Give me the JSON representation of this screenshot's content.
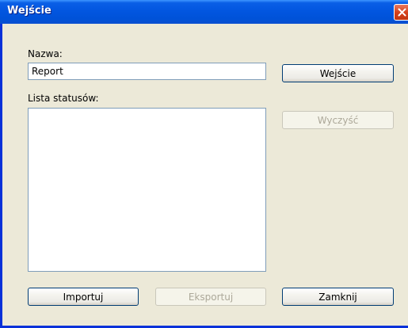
{
  "window": {
    "title": "Wejście"
  },
  "form": {
    "name_label": "Nazwa:",
    "name_value": "Report",
    "status_list_label": "Lista statusów:",
    "status_items": []
  },
  "buttons": {
    "enter": "Wejście",
    "clear": "Wyczyść",
    "import": "Importuj",
    "export": "Eksportuj",
    "close": "Zamknij"
  },
  "icons": {
    "close": "close-icon"
  },
  "colors": {
    "titlebar": "#0052d8",
    "window_bg": "#ece9d8",
    "close_button": "#d6421c",
    "field_border": "#7f9db9",
    "disabled_text": "#aca899"
  }
}
